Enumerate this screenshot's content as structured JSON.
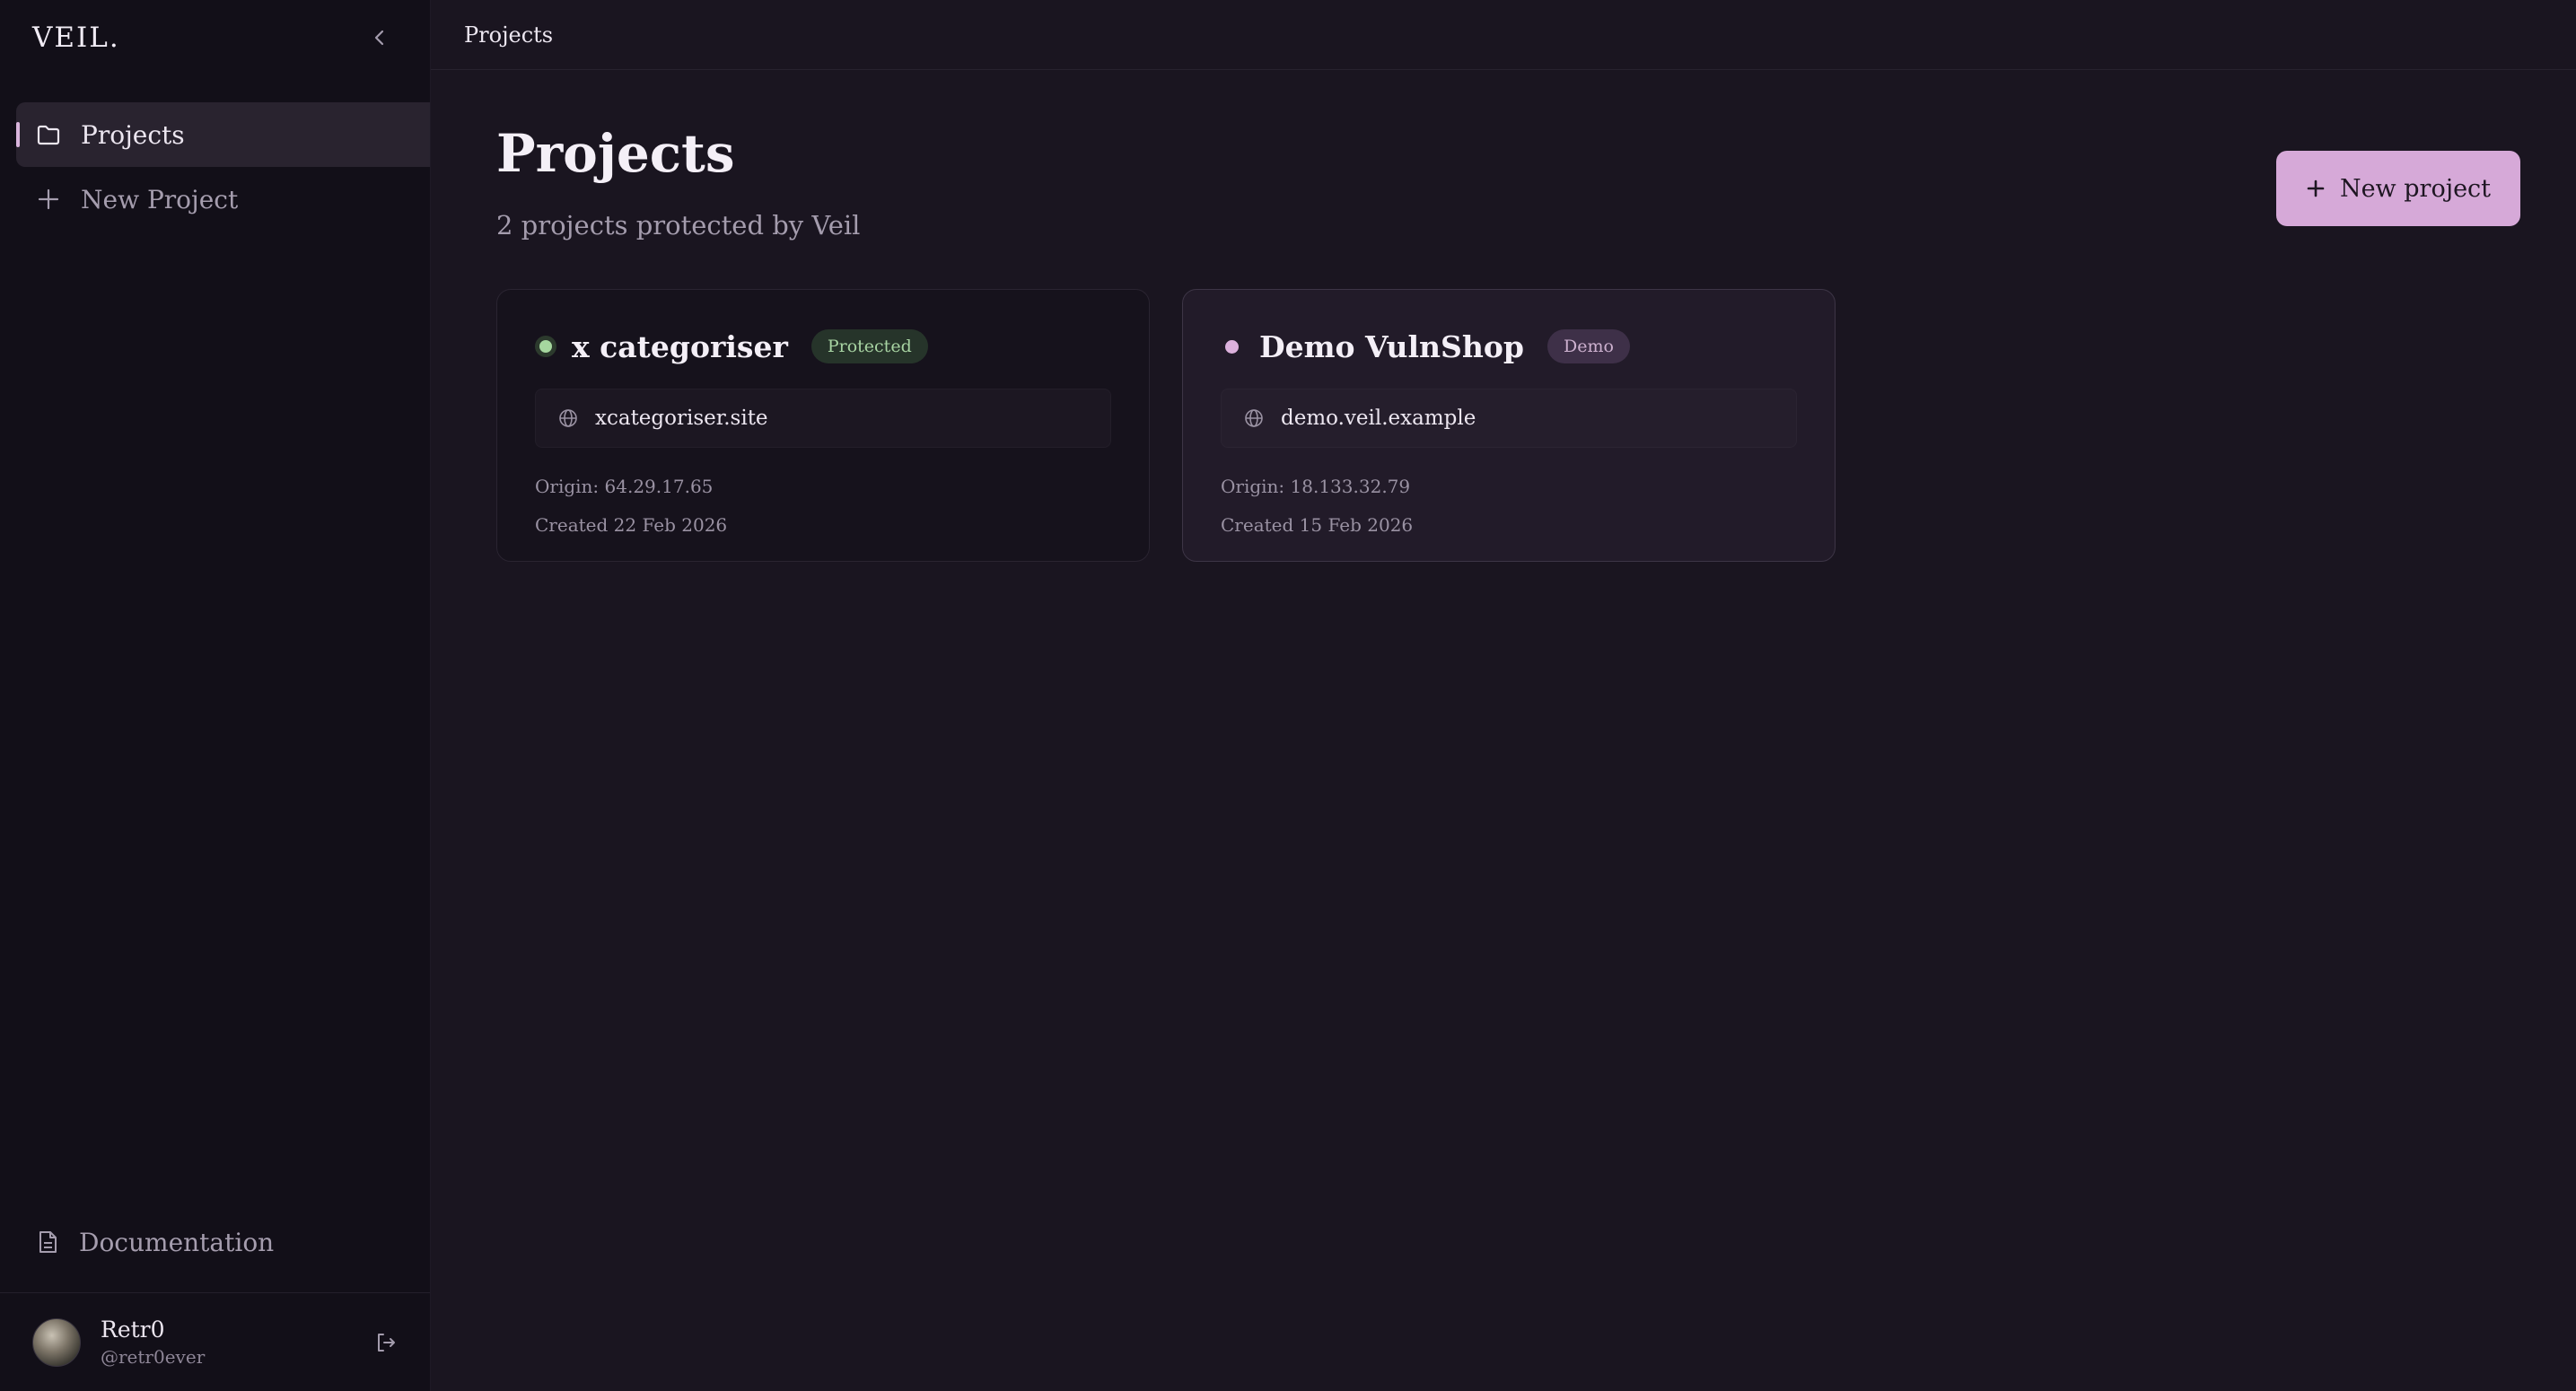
{
  "app": {
    "logo": "VEIL."
  },
  "sidebar": {
    "items": [
      {
        "label": "Projects",
        "icon": "folder-icon",
        "active": true
      },
      {
        "label": "New Project",
        "icon": "plus-icon",
        "active": false
      }
    ],
    "documentation": "Documentation",
    "user": {
      "name": "Retr0",
      "handle": "@retr0ever"
    }
  },
  "topbar": {
    "breadcrumb": "Projects"
  },
  "main": {
    "title": "Projects",
    "subtitle": "2 projects protected by Veil",
    "new_button": "New project",
    "projects": [
      {
        "name": "x categoriser",
        "badge": "Protected",
        "status_color": "#a6d79f",
        "domain": "xcategoriser.site",
        "origin": "Origin: 64.29.17.65",
        "created": "Created 22 Feb 2026"
      },
      {
        "name": "Demo VulnShop",
        "badge": "Demo",
        "status_color": "#dcb1dc",
        "domain": "demo.veil.example",
        "origin": "Origin: 18.133.32.79",
        "created": "Created 15 Feb 2026"
      }
    ]
  },
  "colors": {
    "accent": "#d6a9d8",
    "background": "#1a1520",
    "sidebar": "#120f18"
  }
}
